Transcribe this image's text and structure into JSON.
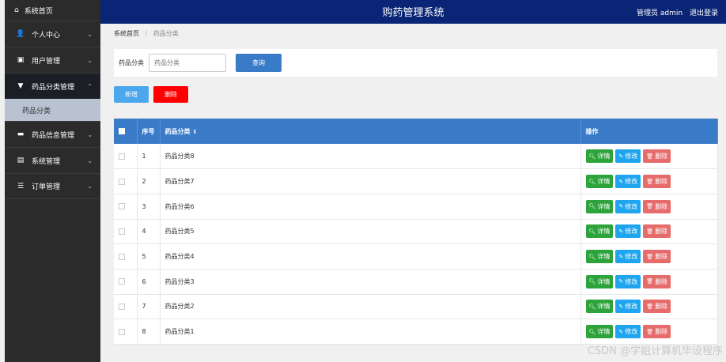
{
  "app": {
    "title": "购药管理系统",
    "user": "管理员 admin",
    "logout": "退出登录"
  },
  "sidebar": {
    "home": "系统首页",
    "items": [
      {
        "label": "个人中心",
        "icon": "user-icon"
      },
      {
        "label": "用户管理",
        "icon": "clipboard-icon"
      },
      {
        "label": "药品分类管理",
        "icon": "pin-icon",
        "active": true
      },
      {
        "label": "药品信息管理",
        "icon": "monitor-icon"
      },
      {
        "label": "系统管理",
        "icon": "chart-icon"
      },
      {
        "label": "订单管理",
        "icon": "sliders-icon"
      }
    ],
    "sub_item": "药品分类"
  },
  "breadcrumb": {
    "home": "系统首页",
    "separator": "/",
    "current": "药品分类"
  },
  "search": {
    "label": "药品分类",
    "placeholder": "药品分类",
    "button": "查询"
  },
  "actions": {
    "add": "新增",
    "delete": "删除"
  },
  "table": {
    "headers": {
      "index": "序号",
      "category": "药品分类",
      "operations": "操作"
    },
    "rows": [
      {
        "index": "1",
        "category": "药品分类8"
      },
      {
        "index": "2",
        "category": "药品分类7"
      },
      {
        "index": "3",
        "category": "药品分类6"
      },
      {
        "index": "4",
        "category": "药品分类5"
      },
      {
        "index": "5",
        "category": "药品分类4"
      },
      {
        "index": "6",
        "category": "药品分类3"
      },
      {
        "index": "7",
        "category": "药品分类2"
      },
      {
        "index": "8",
        "category": "药品分类1"
      }
    ],
    "row_actions": {
      "detail": "详情",
      "edit": "修改",
      "delete": "删除"
    }
  },
  "watermark": "CSDN @学姐计算机毕设程序",
  "colors": {
    "header_bg": "#0a2575",
    "sidebar_bg": "#2b2b2b",
    "table_header": "#3a7bc8",
    "detail": "#2da43b",
    "edit": "#1fa5ef",
    "delete": "#e66c6c"
  }
}
